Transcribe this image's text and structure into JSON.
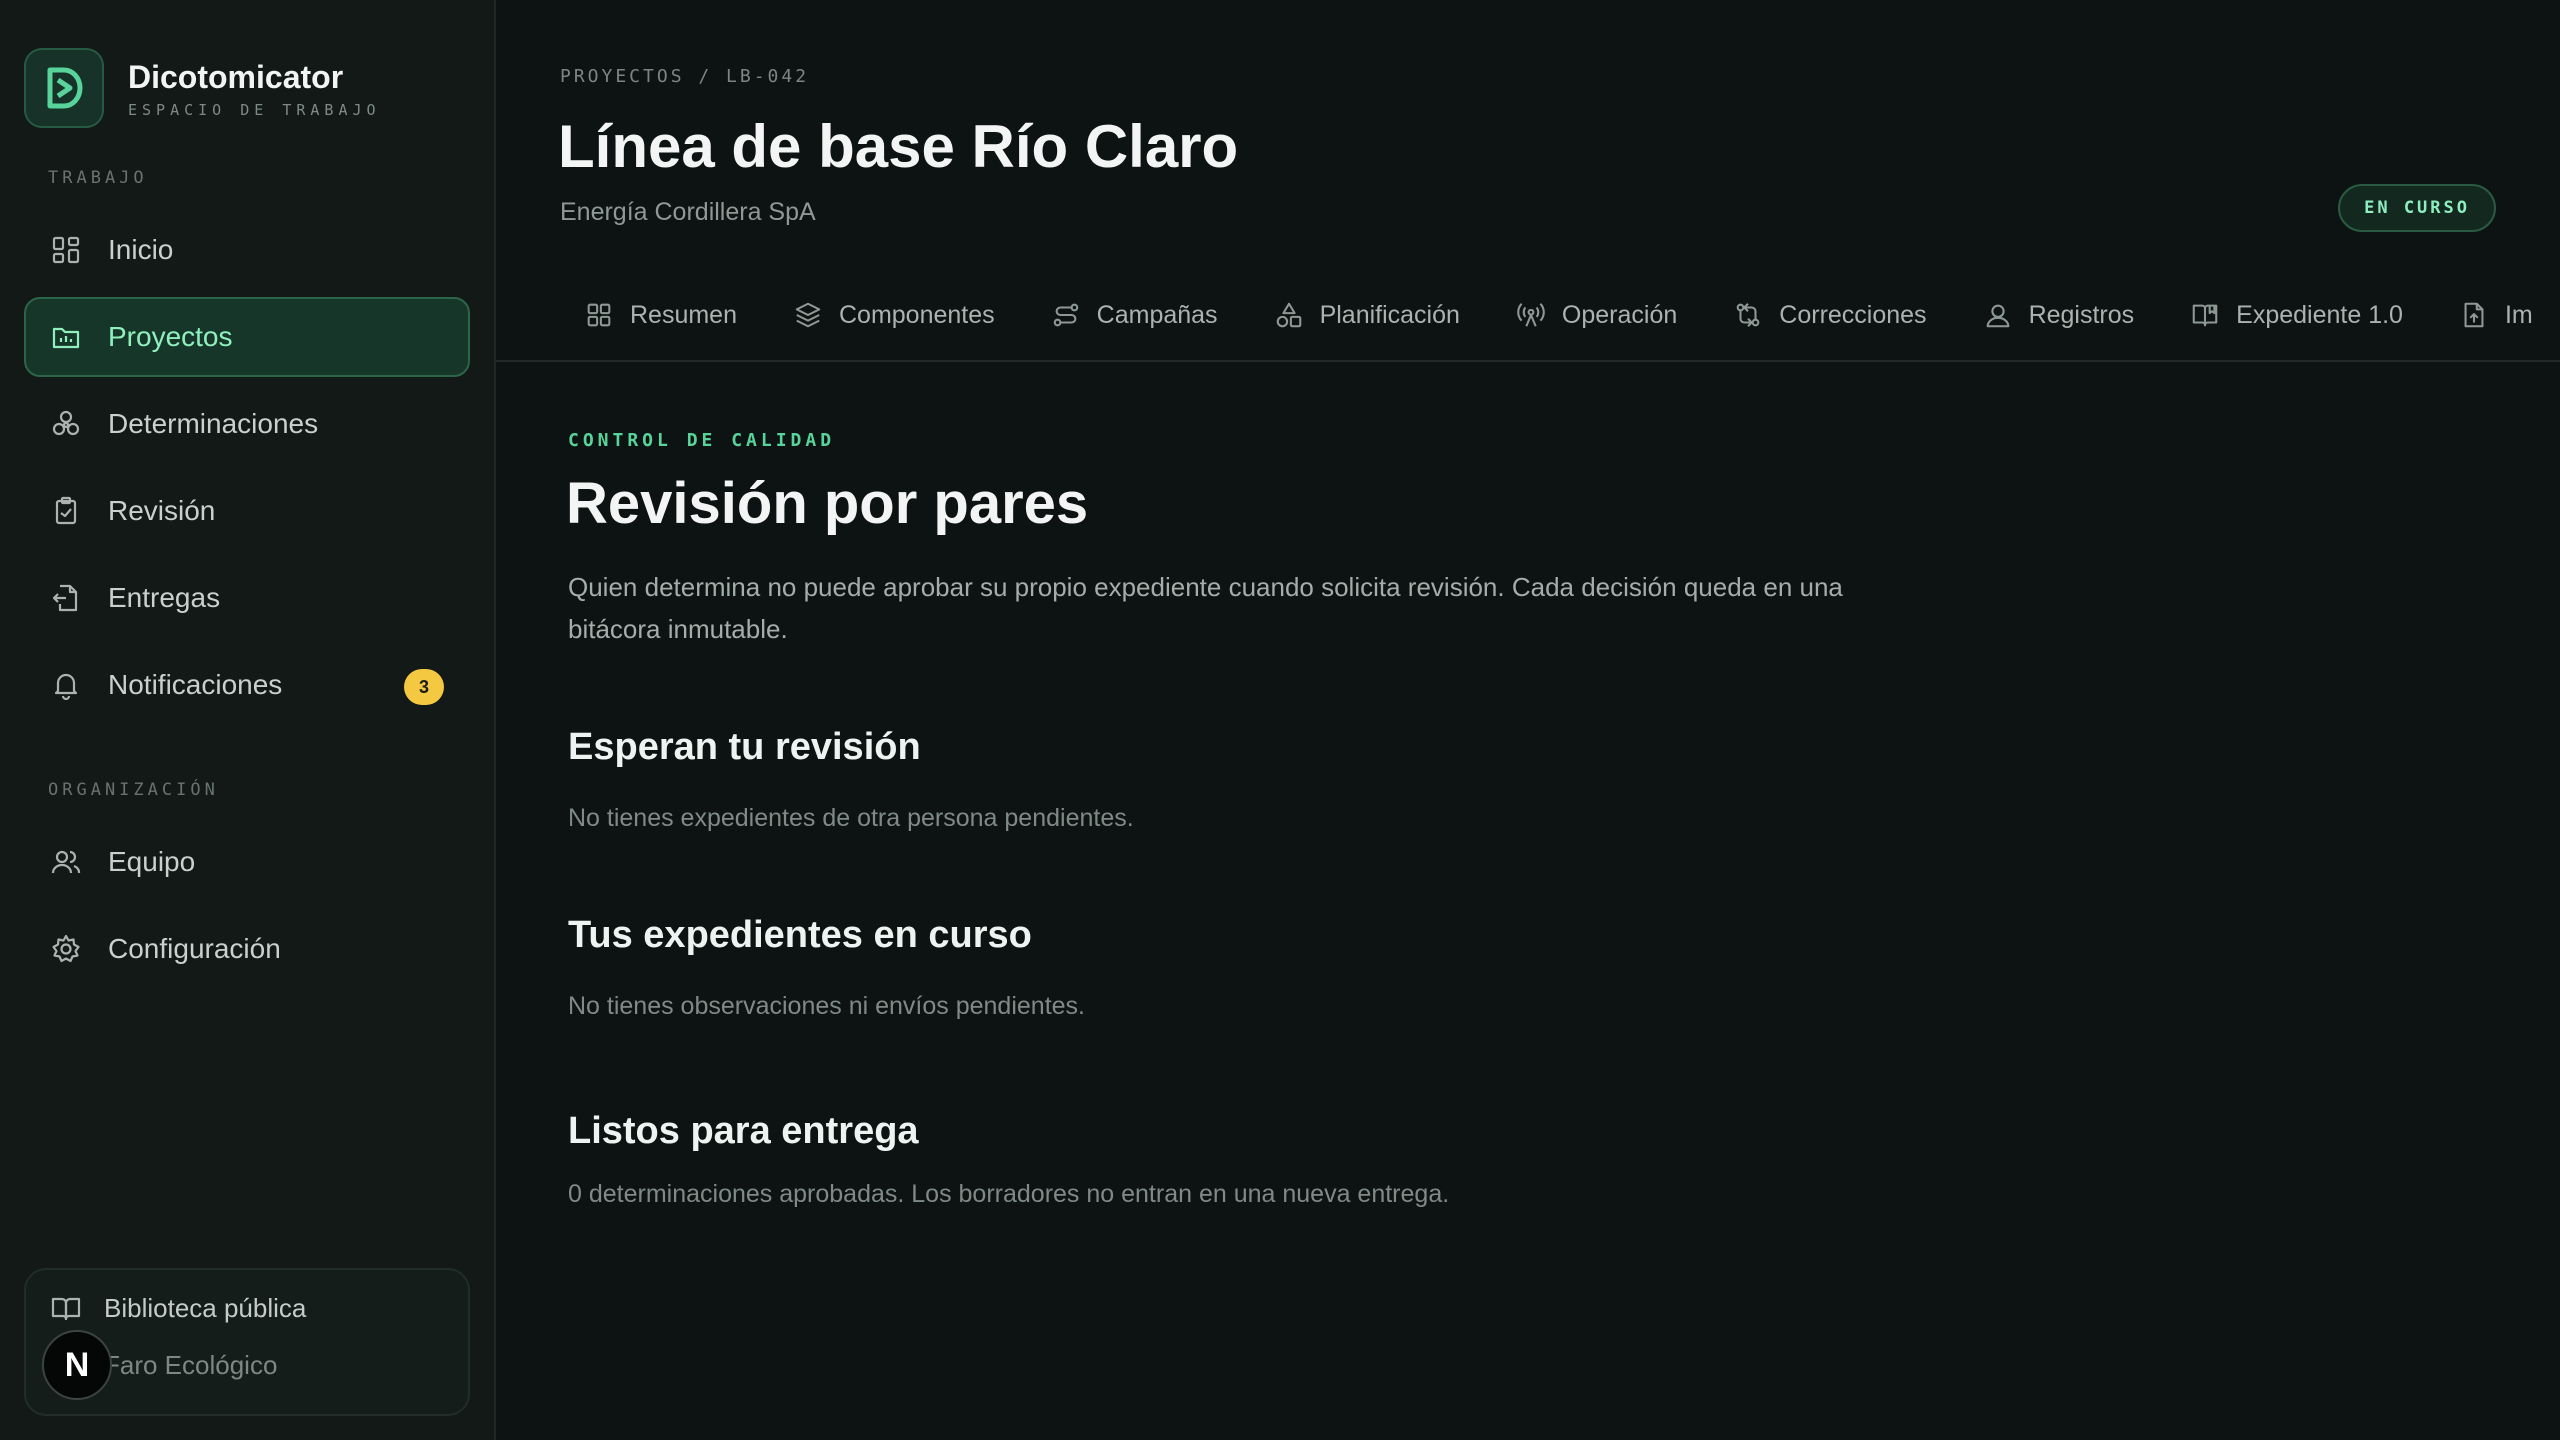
{
  "brand": {
    "name": "Dicotomicator",
    "subtitle": "ESPACIO DE TRABAJO"
  },
  "sidebar": {
    "section_work": "TRABAJO",
    "section_org": "ORGANIZACIÓN",
    "items": [
      {
        "label": "Inicio",
        "icon": "grid-icon"
      },
      {
        "label": "Proyectos",
        "icon": "folder-chart-icon",
        "active": true
      },
      {
        "label": "Determinaciones",
        "icon": "molecule-icon"
      },
      {
        "label": "Revisión",
        "icon": "clipboard-check-icon"
      },
      {
        "label": "Entregas",
        "icon": "document-send-icon"
      },
      {
        "label": "Notificaciones",
        "icon": "bell-icon",
        "badge": "3"
      }
    ],
    "org_items": [
      {
        "label": "Equipo",
        "icon": "users-icon"
      },
      {
        "label": "Configuración",
        "icon": "gear-icon"
      }
    ],
    "bottom": {
      "library": "Biblioteca pública",
      "org": "Faro Ecológico",
      "avatar_letter": "N"
    }
  },
  "header": {
    "breadcrumb": "PROYECTOS / LB-042",
    "title": "Línea de base Río Claro",
    "subtitle": "Energía Cordillera SpA",
    "status": "EN CURSO"
  },
  "tabs": [
    {
      "label": "Resumen",
      "icon": "grid-icon"
    },
    {
      "label": "Componentes",
      "icon": "layers-icon"
    },
    {
      "label": "Campañas",
      "icon": "route-icon"
    },
    {
      "label": "Planificación",
      "icon": "shapes-icon"
    },
    {
      "label": "Operación",
      "icon": "antenna-icon"
    },
    {
      "label": "Correcciones",
      "icon": "git-compare-icon"
    },
    {
      "label": "Registros",
      "icon": "user-pin-icon"
    },
    {
      "label": "Expediente 1.0",
      "icon": "book-icon"
    },
    {
      "label": "Im",
      "icon": "file-upload-icon"
    }
  ],
  "content": {
    "eyebrow": "CONTROL DE CALIDAD",
    "title": "Revisión por pares",
    "lead": "Quien determina no puede aprobar su propio expediente cuando solicita revisión. Cada decisión queda en una bitácora inmutable.",
    "blocks": [
      {
        "title": "Esperan tu revisión",
        "text": "No tienes expedientes de otra persona pendientes."
      },
      {
        "title": "Tus expedientes en curso",
        "text": "No tienes observaciones ni envíos pendientes."
      },
      {
        "title": "Listos para entrega",
        "text": "0 determinaciones aprobadas. Los borradores no entran en una nueva entrega."
      }
    ]
  },
  "colors": {
    "accent": "#58d39a",
    "active_bg": "#17362a",
    "badge": "#f5c842",
    "background": "#0d1312"
  }
}
